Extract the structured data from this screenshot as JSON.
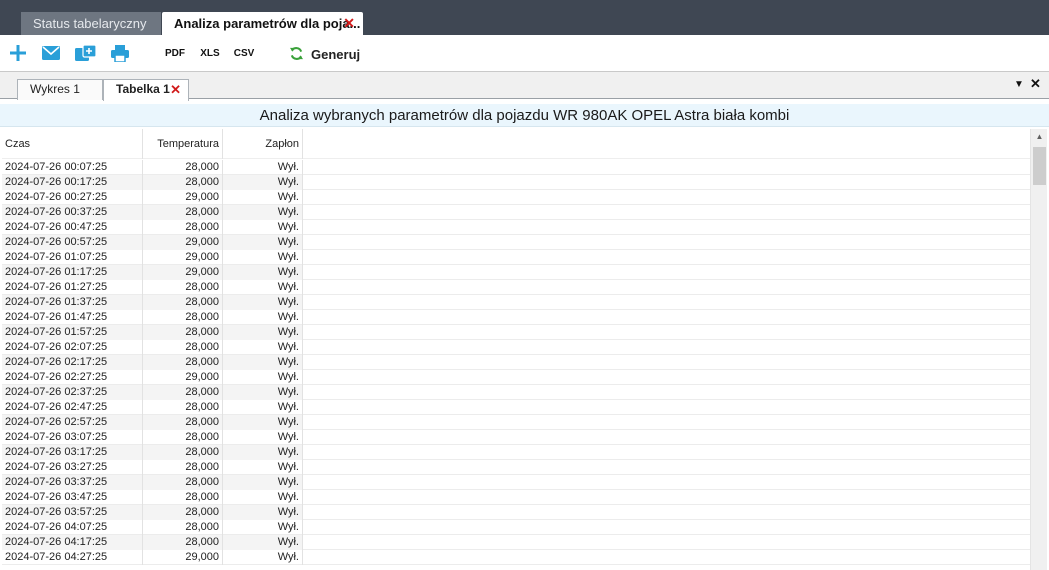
{
  "top_tabs": [
    {
      "label": "Status tabelaryczny"
    },
    {
      "label": "Analiza parametrów dla poja..."
    }
  ],
  "toolbar": {
    "icons": [
      "add-icon",
      "mail-icon",
      "export-icon",
      "print-icon"
    ],
    "pdf_label": "PDF",
    "xls_label": "XLS",
    "csv_label": "CSV",
    "generate_label": "Generuj",
    "colors": {
      "accent": "#2a9fd8",
      "pdf": "#e84a4a",
      "xls": "#6ab04c",
      "csv": "#b08ad6",
      "refresh": "#3aa13a"
    }
  },
  "sub_tabs": [
    {
      "label": "Wykres 1"
    },
    {
      "label": "Tabelka 1"
    }
  ],
  "report_title": "Analiza wybranych parametrów dla pojazdu WR 980AK OPEL Astra biała kombi",
  "table": {
    "headers": [
      "Czas",
      "Temperatura",
      "Zapłon"
    ],
    "rows": [
      [
        "2024-07-26 00:07:25",
        "28,000",
        "Wył."
      ],
      [
        "2024-07-26 00:17:25",
        "28,000",
        "Wył."
      ],
      [
        "2024-07-26 00:27:25",
        "29,000",
        "Wył."
      ],
      [
        "2024-07-26 00:37:25",
        "28,000",
        "Wył."
      ],
      [
        "2024-07-26 00:47:25",
        "28,000",
        "Wył."
      ],
      [
        "2024-07-26 00:57:25",
        "29,000",
        "Wył."
      ],
      [
        "2024-07-26 01:07:25",
        "29,000",
        "Wył."
      ],
      [
        "2024-07-26 01:17:25",
        "29,000",
        "Wył."
      ],
      [
        "2024-07-26 01:27:25",
        "28,000",
        "Wył."
      ],
      [
        "2024-07-26 01:37:25",
        "28,000",
        "Wył."
      ],
      [
        "2024-07-26 01:47:25",
        "28,000",
        "Wył."
      ],
      [
        "2024-07-26 01:57:25",
        "28,000",
        "Wył."
      ],
      [
        "2024-07-26 02:07:25",
        "28,000",
        "Wył."
      ],
      [
        "2024-07-26 02:17:25",
        "28,000",
        "Wył."
      ],
      [
        "2024-07-26 02:27:25",
        "29,000",
        "Wył."
      ],
      [
        "2024-07-26 02:37:25",
        "28,000",
        "Wył."
      ],
      [
        "2024-07-26 02:47:25",
        "28,000",
        "Wył."
      ],
      [
        "2024-07-26 02:57:25",
        "28,000",
        "Wył."
      ],
      [
        "2024-07-26 03:07:25",
        "28,000",
        "Wył."
      ],
      [
        "2024-07-26 03:17:25",
        "28,000",
        "Wył."
      ],
      [
        "2024-07-26 03:27:25",
        "28,000",
        "Wył."
      ],
      [
        "2024-07-26 03:37:25",
        "28,000",
        "Wył."
      ],
      [
        "2024-07-26 03:47:25",
        "28,000",
        "Wył."
      ],
      [
        "2024-07-26 03:57:25",
        "28,000",
        "Wył."
      ],
      [
        "2024-07-26 04:07:25",
        "28,000",
        "Wył."
      ],
      [
        "2024-07-26 04:17:25",
        "28,000",
        "Wył."
      ],
      [
        "2024-07-26 04:27:25",
        "29,000",
        "Wył."
      ]
    ]
  }
}
